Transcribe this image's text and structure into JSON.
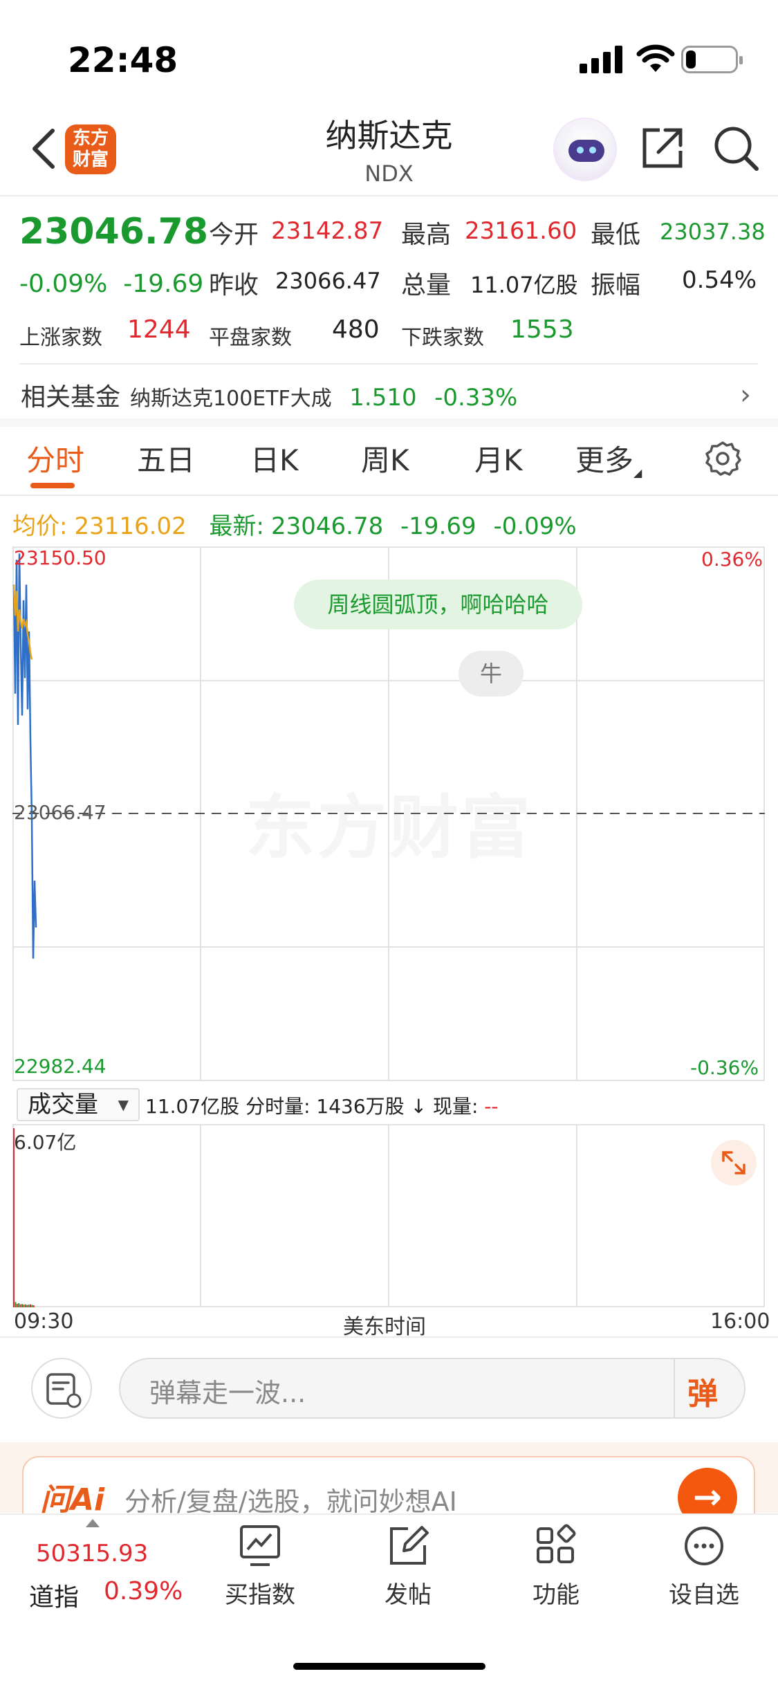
{
  "status_bar": {
    "time": "22:48"
  },
  "header": {
    "logo": [
      "东方",
      "财富"
    ],
    "title": "纳斯达克",
    "code": "NDX"
  },
  "quote": {
    "price": "23046.78",
    "change_pct": "-0.09%",
    "change": "-19.69",
    "open_label": "今开",
    "open": "23142.87",
    "high_label": "最高",
    "high": "23161.60",
    "low_label": "最低",
    "low": "23037.38",
    "prev_close_label": "昨收",
    "prev_close": "23066.47",
    "volume_label": "总量",
    "volume": "11.07亿股",
    "amplitude_label": "振幅",
    "amplitude": "0.54%",
    "up_label": "上涨家数",
    "up_count": "1244",
    "flat_label": "平盘家数",
    "flat_count": "480",
    "down_label": "下跌家数",
    "down_count": "1553"
  },
  "fund": {
    "label": "相关基金",
    "name": "纳斯达克100ETF大成",
    "price": "1.510",
    "pct": "-0.33%"
  },
  "tabs": [
    "分时",
    "五日",
    "日K",
    "周K",
    "月K",
    "更多"
  ],
  "avg_row": {
    "avg_label": "均价:",
    "avg": "23116.02",
    "latest_label": "最新:",
    "latest": "23046.78",
    "change": "-19.69",
    "pct": "-0.09%"
  },
  "chart_labels": {
    "top": "23150.50",
    "mid": "23066.47",
    "bottom": "22982.44",
    "top_pct": "0.36%",
    "bottom_pct": "-0.36%"
  },
  "bubble": "周线圆弧顶，啊哈哈哈",
  "niu_bubble": "牛",
  "watermark": "东方财富",
  "chart_data": {
    "type": "line",
    "ylim": [
      22982.44,
      23150.5
    ],
    "prev_close": 23066.47,
    "series": [
      {
        "values": [
          23140,
          23105,
          23148,
          23095,
          23150,
          23120,
          23098,
          23135,
          23110,
          23140,
          23100,
          23125,
          23090,
          23065,
          23020,
          23045,
          23030
        ]
      },
      {
        "values": [
          23140,
          23130,
          23138,
          23125,
          23132,
          23128,
          23126,
          23129,
          23127,
          23128,
          23124,
          23122,
          23118,
          23116
        ]
      }
    ]
  },
  "volume": {
    "selector": "成交量",
    "total": "11.07亿股",
    "minute_label": "分时量:",
    "minute": "1436万股",
    "now_label": "现量:",
    "now": "--",
    "max": "6.07亿",
    "bars": [
      6.07,
      0.18,
      0.12,
      0.14,
      0.1,
      0.11,
      0.09,
      0.1,
      0.08,
      0.09,
      0.1,
      0.08,
      0.07
    ]
  },
  "time_axis": {
    "start": "09:30",
    "mid": "美东时间",
    "end": "16:00"
  },
  "comment": {
    "placeholder": "弹幕走一波...",
    "danmu": "弹"
  },
  "ai": {
    "logo": "问Ai",
    "placeholder": "分析/复盘/选股，就问妙想AI"
  },
  "bottom_nav": {
    "index_value": "50315.93",
    "index_name": "道指",
    "index_pct": "0.39%",
    "items": [
      "买指数",
      "发帖",
      "功能",
      "设自选"
    ]
  }
}
